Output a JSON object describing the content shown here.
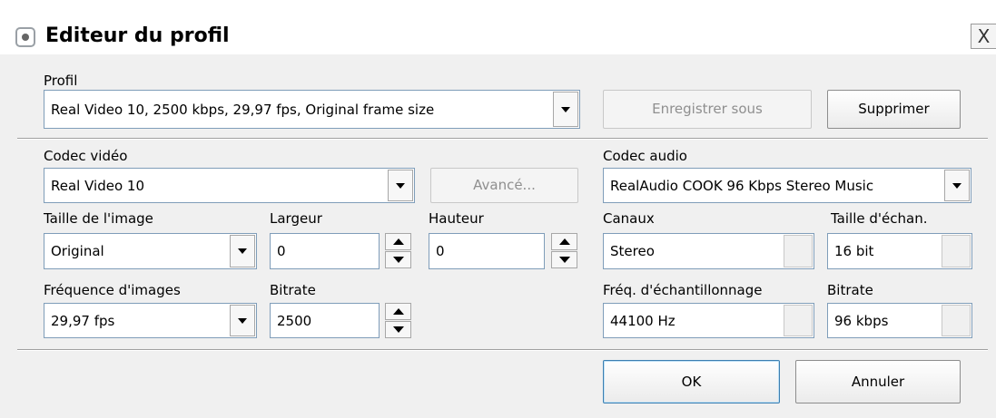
{
  "window": {
    "title": "Editeur du profil",
    "close_label": "X"
  },
  "profile": {
    "label": "Profil",
    "value": "Real Video 10, 2500 kbps, 29,97 fps, Original frame size",
    "save_as": "Enregistrer sous",
    "delete": "Supprimer"
  },
  "video": {
    "codec_label": "Codec vidéo",
    "codec_value": "Real Video 10",
    "advanced": "Avancé...",
    "size_label": "Taille de l'image",
    "size_value": "Original",
    "width_label": "Largeur",
    "width_value": "0",
    "height_label": "Hauteur",
    "height_value": "0",
    "fps_label": "Fréquence d'images",
    "fps_value": "29,97 fps",
    "bitrate_label": "Bitrate",
    "bitrate_value": "2500"
  },
  "audio": {
    "codec_label": "Codec audio",
    "codec_value": "RealAudio COOK 96 Kbps Stereo Music",
    "channels_label": "Canaux",
    "channels_value": "Stereo",
    "sample_size_label": "Taille d'échan.",
    "sample_size_value": "16 bit",
    "sample_rate_label": "Fréq. d'échantillonnage",
    "sample_rate_value": "44100 Hz",
    "bitrate_label": "Bitrate",
    "bitrate_value": "96 kbps"
  },
  "footer": {
    "ok": "OK",
    "cancel": "Annuler"
  }
}
